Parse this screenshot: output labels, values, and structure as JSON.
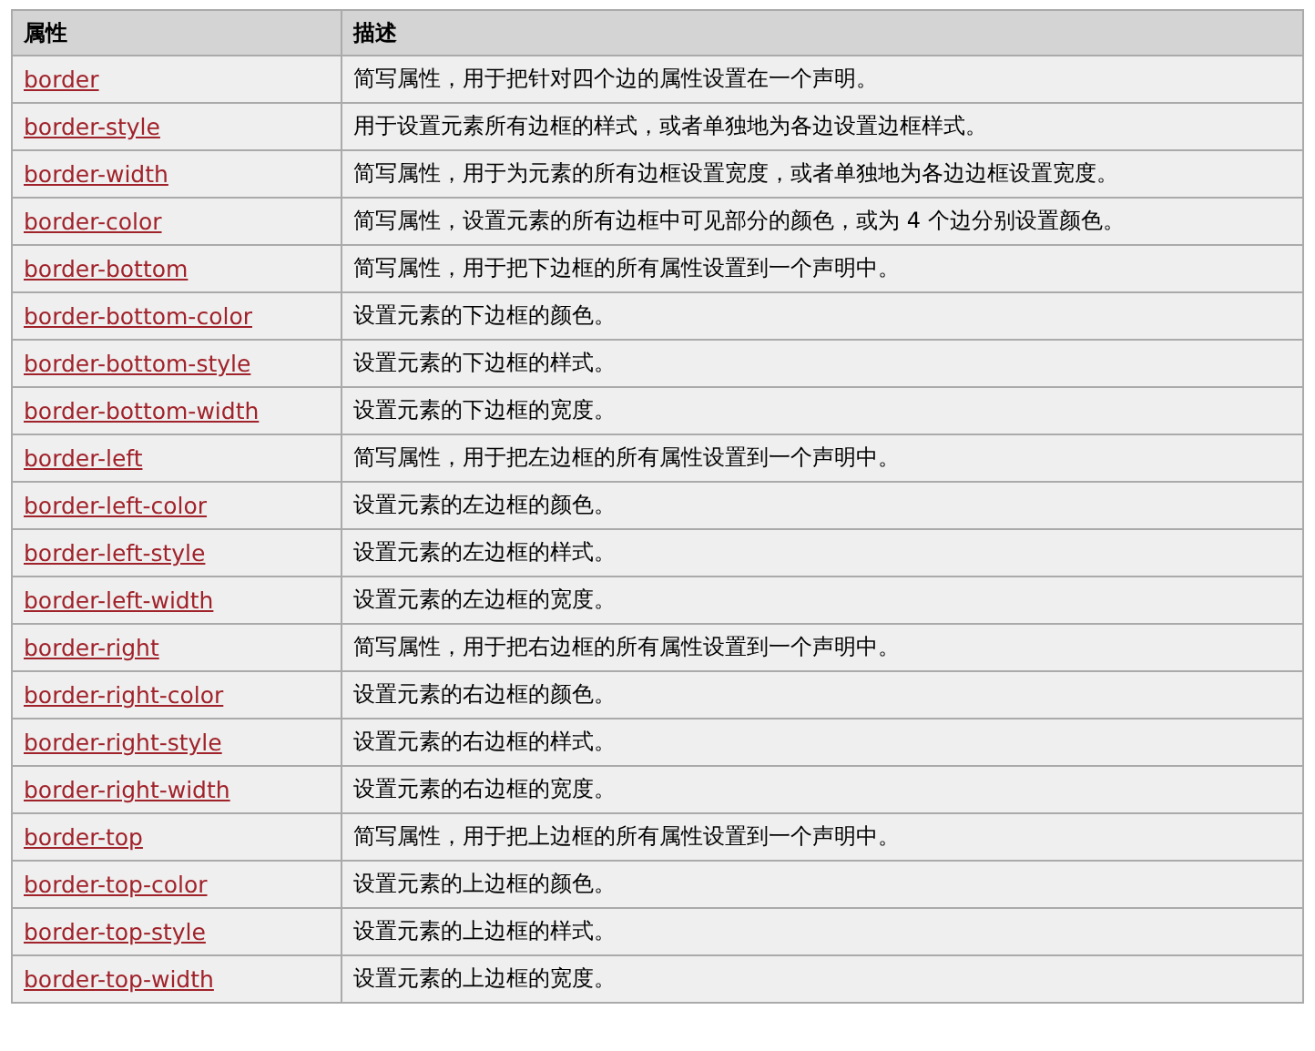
{
  "table": {
    "columns": [
      "属性",
      "描述"
    ],
    "rows": [
      {
        "property": "border",
        "description": "简写属性，用于把针对四个边的属性设置在一个声明。"
      },
      {
        "property": "border-style",
        "description": "用于设置元素所有边框的样式，或者单独地为各边设置边框样式。"
      },
      {
        "property": "border-width",
        "description": "简写属性，用于为元素的所有边框设置宽度，或者单独地为各边边框设置宽度。"
      },
      {
        "property": "border-color",
        "description": "简写属性，设置元素的所有边框中可见部分的颜色，或为 4 个边分别设置颜色。"
      },
      {
        "property": "border-bottom",
        "description": "简写属性，用于把下边框的所有属性设置到一个声明中。"
      },
      {
        "property": "border-bottom-color",
        "description": "设置元素的下边框的颜色。"
      },
      {
        "property": "border-bottom-style",
        "description": "设置元素的下边框的样式。"
      },
      {
        "property": "border-bottom-width",
        "description": "设置元素的下边框的宽度。"
      },
      {
        "property": "border-left",
        "description": "简写属性，用于把左边框的所有属性设置到一个声明中。"
      },
      {
        "property": "border-left-color",
        "description": "设置元素的左边框的颜色。"
      },
      {
        "property": "border-left-style",
        "description": "设置元素的左边框的样式。"
      },
      {
        "property": "border-left-width",
        "description": "设置元素的左边框的宽度。"
      },
      {
        "property": "border-right",
        "description": "简写属性，用于把右边框的所有属性设置到一个声明中。"
      },
      {
        "property": "border-right-color",
        "description": "设置元素的右边框的颜色。"
      },
      {
        "property": "border-right-style",
        "description": "设置元素的右边框的样式。"
      },
      {
        "property": "border-right-width",
        "description": "设置元素的右边框的宽度。"
      },
      {
        "property": "border-top",
        "description": "简写属性，用于把上边框的所有属性设置到一个声明中。"
      },
      {
        "property": "border-top-color",
        "description": "设置元素的上边框的颜色。"
      },
      {
        "property": "border-top-style",
        "description": "设置元素的上边框的样式。"
      },
      {
        "property": "border-top-width",
        "description": "设置元素的上边框的宽度。"
      }
    ]
  }
}
